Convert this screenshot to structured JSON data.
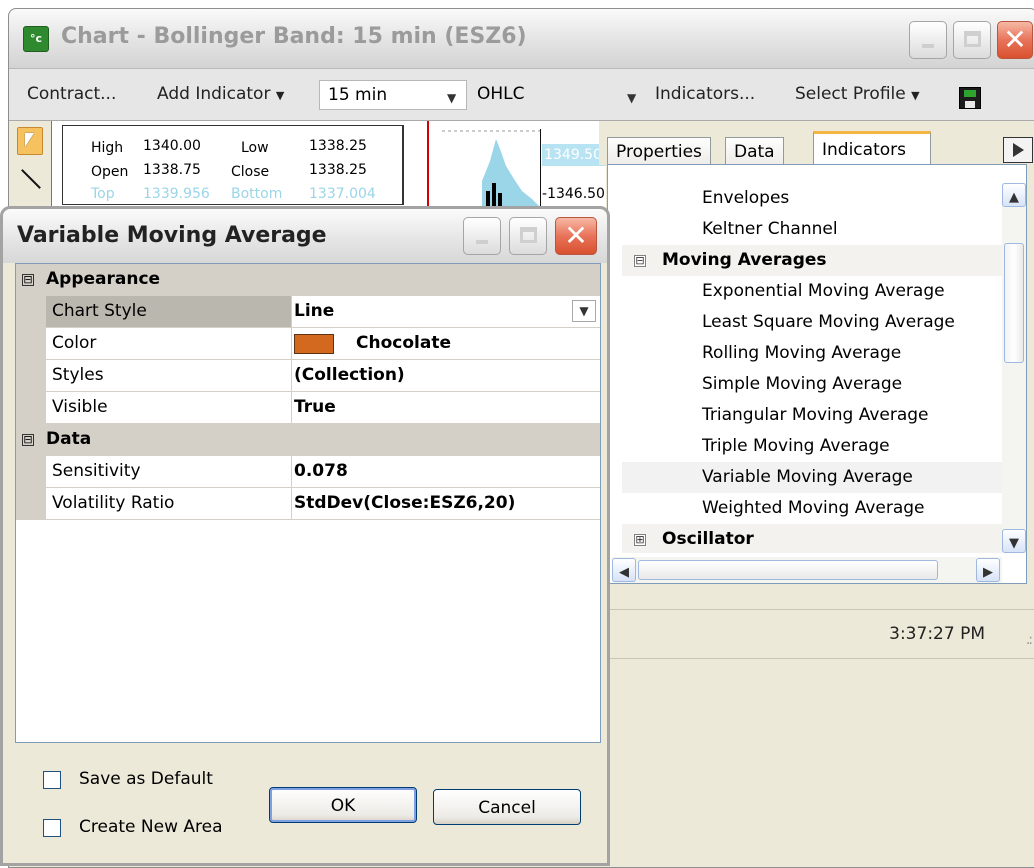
{
  "window": {
    "title": "Chart - Bollinger Band: 15 min (ESZ6)",
    "icon": "chart-app-icon"
  },
  "toolbar": {
    "contract": "Contract...",
    "add_indicator": "Add Indicator",
    "interval": "15 min",
    "chart_type": "OHLC",
    "indicators": "Indicators...",
    "select_profile": "Select Profile"
  },
  "chart": {
    "ohlc": {
      "high_label": "High",
      "high": "1340.00",
      "low_label": "Low",
      "low": "1338.25",
      "open_label": "Open",
      "open": "1338.75",
      "close_label": "Close",
      "close": "1338.25",
      "top_label": "Top",
      "top": "1339.956",
      "bottom_label": "Bottom",
      "bottom": "1337.004"
    },
    "price_high": "1349.50",
    "price_mid": "1346.50"
  },
  "tabs": [
    {
      "label": "Properties"
    },
    {
      "label": "Data"
    },
    {
      "label": "Indicators"
    }
  ],
  "indicator_list": [
    {
      "label": "Envelopes",
      "type": "item"
    },
    {
      "label": "Keltner Channel",
      "type": "item"
    },
    {
      "label": "Moving Averages",
      "type": "group",
      "expander": "⊟"
    },
    {
      "label": "Exponential Moving Average",
      "type": "item"
    },
    {
      "label": "Least Square Moving Average",
      "type": "item"
    },
    {
      "label": "Rolling Moving Average",
      "type": "item"
    },
    {
      "label": "Simple Moving Average",
      "type": "item"
    },
    {
      "label": "Triangular Moving Average",
      "type": "item"
    },
    {
      "label": "Triple Moving Average",
      "type": "item"
    },
    {
      "label": "Variable Moving Average",
      "type": "item",
      "selected": true
    },
    {
      "label": "Weighted Moving Average",
      "type": "item"
    },
    {
      "label": "Oscillator",
      "type": "group",
      "expander": "⊞"
    }
  ],
  "status_bar": {
    "time": "3:37:27 PM"
  },
  "dialog": {
    "title": "Variable Moving Average",
    "categories": [
      {
        "name": "Appearance",
        "expander": "⊟",
        "properties": [
          {
            "name": "Chart Style",
            "value": "Line",
            "selected": true,
            "dropdown": true
          },
          {
            "name": "Color",
            "value": "Chocolate",
            "swatch": "#d2691e"
          },
          {
            "name": "Styles",
            "value": "(Collection)"
          },
          {
            "name": "Visible",
            "value": "True"
          }
        ]
      },
      {
        "name": "Data",
        "expander": "⊟",
        "properties": [
          {
            "name": "Sensitivity",
            "value": "0.078"
          },
          {
            "name": "Volatility Ratio",
            "value": "StdDev(Close:ESZ6,20)"
          }
        ]
      }
    ],
    "save_as_default": "Save as Default",
    "create_new_area": "Create New Area",
    "ok": "OK",
    "cancel": "Cancel"
  },
  "colors": {
    "tab_accent": "#f4b547",
    "chart_band": "#9ad5e8",
    "price_marker": "#d20000"
  }
}
